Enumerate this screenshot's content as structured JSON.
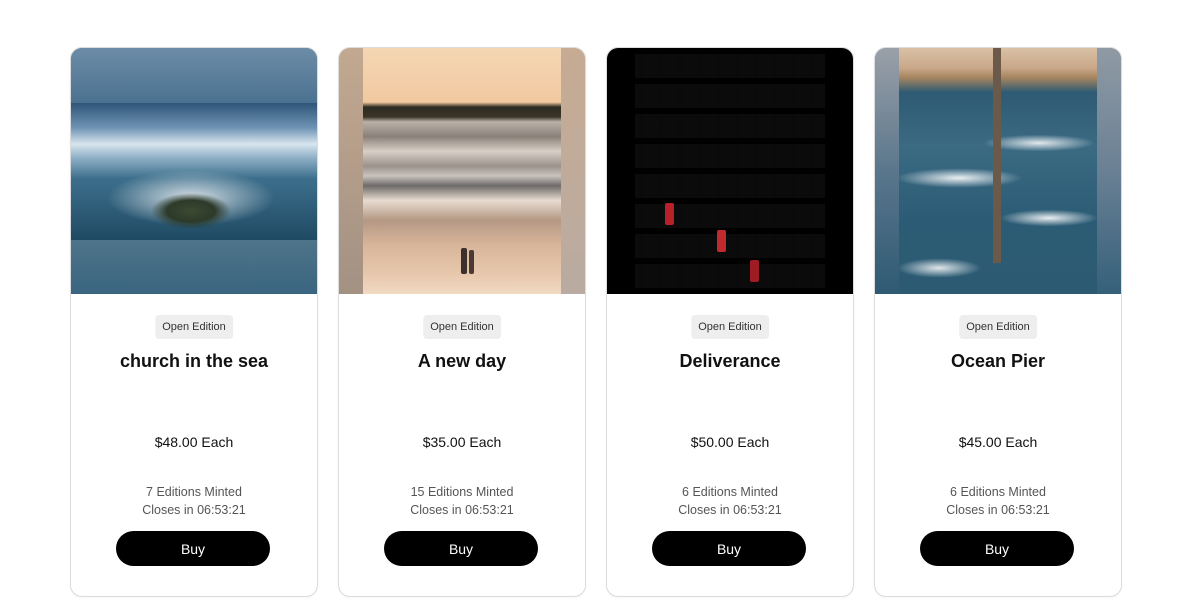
{
  "cards": [
    {
      "badge": "Open Edition",
      "title": "church in the sea",
      "price": "$48.00 Each",
      "minted": "7 Editions Minted",
      "closes": "Closes in 06:53:21",
      "buy_label": "Buy"
    },
    {
      "badge": "Open Edition",
      "title": "A new day",
      "price": "$35.00 Each",
      "minted": "15 Editions Minted",
      "closes": "Closes in 06:53:21",
      "buy_label": "Buy"
    },
    {
      "badge": "Open Edition",
      "title": "Deliverance",
      "price": "$50.00 Each",
      "minted": "6 Editions Minted",
      "closes": "Closes in 06:53:21",
      "buy_label": "Buy"
    },
    {
      "badge": "Open Edition",
      "title": "Ocean Pier",
      "price": "$45.00 Each",
      "minted": "6 Editions Minted",
      "closes": "Closes in 06:53:21",
      "buy_label": "Buy"
    }
  ],
  "colors": {
    "button_bg": "#000000",
    "button_text": "#ffffff",
    "badge_bg": "#eeeeee",
    "card_border": "#dcdcdc"
  }
}
